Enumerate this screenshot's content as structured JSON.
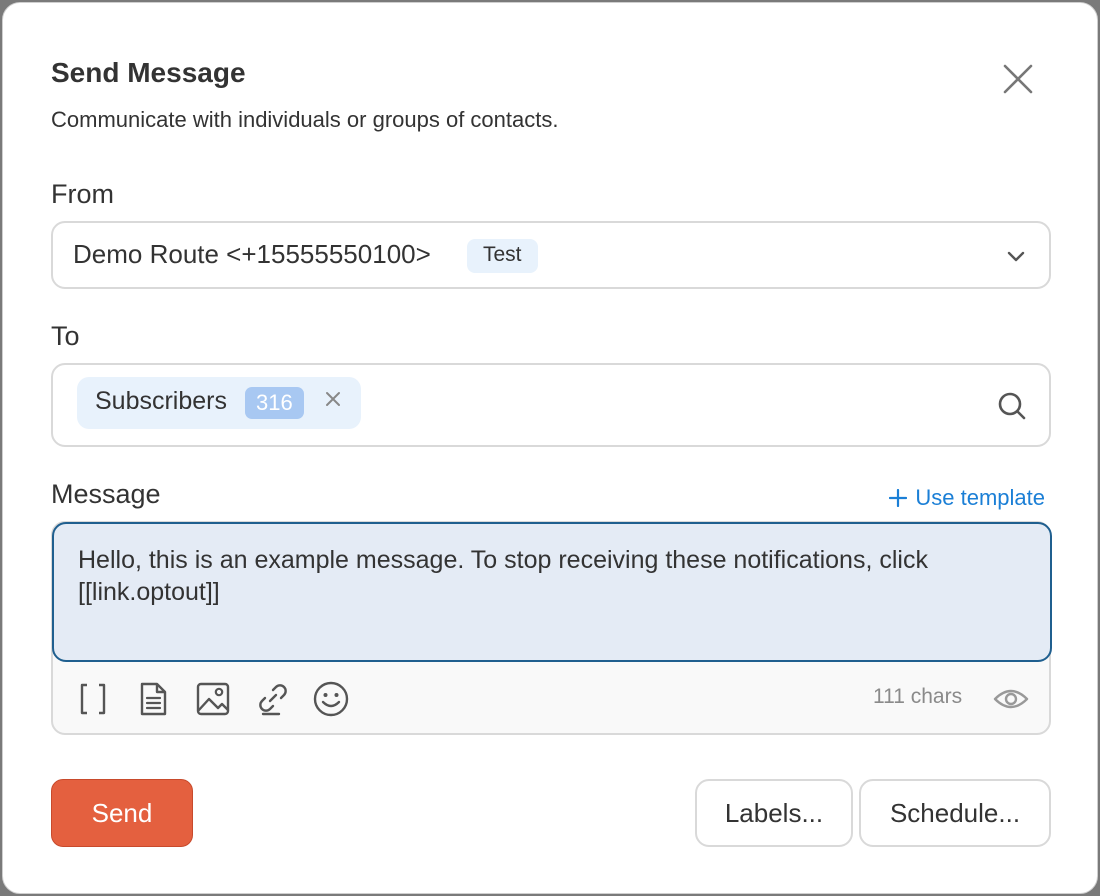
{
  "modal": {
    "title": "Send Message",
    "subtitle": "Communicate with individuals or groups of contacts.",
    "close_icon": "close-icon"
  },
  "from": {
    "label": "From",
    "value": "Demo Route <+15555550100>",
    "badge": "Test",
    "dropdown_icon": "chevron-down-icon"
  },
  "to": {
    "label": "To",
    "chips": [
      {
        "label": "Subscribers",
        "count": "316"
      }
    ],
    "search_icon": "search-icon"
  },
  "message": {
    "label": "Message",
    "use_template": "Use template",
    "text": "Hello, this is an example message. To stop receiving these notifications, click [[link.optout]]",
    "char_count": "111 chars",
    "toolbar": [
      "brackets-icon",
      "document-icon",
      "image-icon",
      "link-icon",
      "emoji-icon",
      "eye-icon"
    ]
  },
  "actions": {
    "send": "Send",
    "labels": "Labels...",
    "schedule": "Schedule..."
  },
  "colors": {
    "accent": "#1b7fd6",
    "send": "#e4603f",
    "chip_bg": "#e8f2fc",
    "count_bg": "#a8c8f2",
    "focus_border": "#1f5f8f"
  }
}
